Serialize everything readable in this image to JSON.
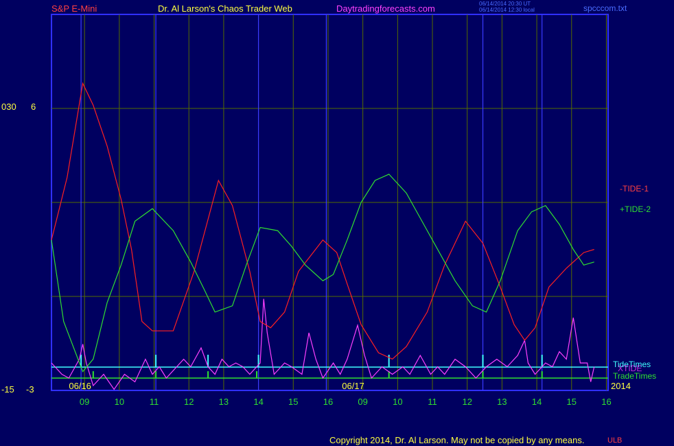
{
  "header": {
    "symbol": "S&P E-Mini",
    "site_title": "Dr. Al Larson's Chaos Trader Web",
    "site_url": "Daytradingforecasts.com",
    "timestamp_1": "06/14/2014 20:30 UT",
    "timestamp_2": "06/14/2014 12:30 local",
    "file_name": "spcccom.txt"
  },
  "footer": {
    "copyright": "Copyright 2014, Dr. Al Larson. May not be copied by any means.",
    "mark": "ULB"
  },
  "colors": {
    "background": "#000060",
    "frame": "#3030ff",
    "grid": "#556b00",
    "tide1": "#ff2020",
    "tide2": "#30e030",
    "xtide": "#ff40ff",
    "tidetimes": "#40ffff",
    "tradetimes": "#30e030",
    "day_marker": "#3a3aff",
    "axis_text": "#ffff40",
    "tick_text": "#30e030"
  },
  "chart_data": {
    "type": "line",
    "y_axis_labels": {
      "top_left": "030",
      "top_right": "6",
      "bottom_left": "-15",
      "bottom_right": "-3"
    },
    "date_labels": [
      "06/16",
      "06/17"
    ],
    "year_label": "2014",
    "x_ticks": [
      "09",
      "10",
      "11",
      "12",
      "13",
      "14",
      "15",
      "16",
      "09",
      "10",
      "11",
      "12",
      "13",
      "14",
      "15",
      "16"
    ],
    "x_range": [
      0,
      16
    ],
    "y_range": [
      -3,
      6
    ],
    "series": [
      {
        "name": "-TIDE-1",
        "points": [
          [
            0,
            1.8
          ],
          [
            0.45,
            3.8
          ],
          [
            0.9,
            6.8
          ],
          [
            1.2,
            6.1
          ],
          [
            1.6,
            4.8
          ],
          [
            2.0,
            3.1
          ],
          [
            2.3,
            1.5
          ],
          [
            2.6,
            -0.8
          ],
          [
            2.9,
            -1.1
          ],
          [
            3.5,
            -1.1
          ],
          [
            4.1,
            0.8
          ],
          [
            4.8,
            3.7
          ],
          [
            5.2,
            2.9
          ],
          [
            5.7,
            0.8
          ],
          [
            6.0,
            -0.8
          ],
          [
            6.3,
            -1.0
          ],
          [
            6.7,
            -0.5
          ],
          [
            7.1,
            0.8
          ],
          [
            7.8,
            1.8
          ],
          [
            8.2,
            1.4
          ],
          [
            8.5,
            0.4
          ],
          [
            8.9,
            -0.9
          ],
          [
            9.4,
            -1.8
          ],
          [
            9.8,
            -2.0
          ],
          [
            10.2,
            -1.6
          ],
          [
            10.8,
            -0.5
          ],
          [
            11.3,
            1.0
          ],
          [
            11.9,
            2.4
          ],
          [
            12.4,
            1.7
          ],
          [
            12.9,
            0.3
          ],
          [
            13.3,
            -0.9
          ],
          [
            13.6,
            -1.4
          ],
          [
            13.9,
            -1.0
          ],
          [
            14.3,
            0.3
          ],
          [
            14.8,
            0.9
          ],
          [
            15.3,
            1.4
          ],
          [
            15.6,
            1.5
          ]
        ]
      },
      {
        "name": "+TIDE-2",
        "points": [
          [
            0,
            1.8
          ],
          [
            0.35,
            -0.8
          ],
          [
            0.9,
            -2.4
          ],
          [
            1.2,
            -2.0
          ],
          [
            1.6,
            -0.2
          ],
          [
            2.0,
            1.0
          ],
          [
            2.4,
            2.4
          ],
          [
            2.9,
            2.8
          ],
          [
            3.5,
            2.1
          ],
          [
            4.0,
            1.1
          ],
          [
            4.4,
            0.2
          ],
          [
            4.7,
            -0.5
          ],
          [
            5.2,
            -0.3
          ],
          [
            5.6,
            1.0
          ],
          [
            6.0,
            2.2
          ],
          [
            6.5,
            2.1
          ],
          [
            6.9,
            1.6
          ],
          [
            7.3,
            1.0
          ],
          [
            7.8,
            0.5
          ],
          [
            8.1,
            0.7
          ],
          [
            8.5,
            1.8
          ],
          [
            8.9,
            3.0
          ],
          [
            9.3,
            3.7
          ],
          [
            9.7,
            3.9
          ],
          [
            10.2,
            3.3
          ],
          [
            10.7,
            2.3
          ],
          [
            11.2,
            1.3
          ],
          [
            11.6,
            0.5
          ],
          [
            12.1,
            -0.3
          ],
          [
            12.5,
            -0.5
          ],
          [
            12.9,
            0.5
          ],
          [
            13.4,
            2.1
          ],
          [
            13.8,
            2.7
          ],
          [
            14.2,
            2.9
          ],
          [
            14.6,
            2.3
          ],
          [
            15.0,
            1.5
          ],
          [
            15.3,
            1.0
          ],
          [
            15.6,
            1.1
          ]
        ]
      },
      {
        "name": "XTIDE",
        "points": [
          [
            0,
            0.2
          ],
          [
            0.3,
            -0.1
          ],
          [
            0.5,
            -0.2
          ],
          [
            0.8,
            0.3
          ],
          [
            0.9,
            0.7
          ],
          [
            1.0,
            0.2
          ],
          [
            1.2,
            -0.4
          ],
          [
            1.5,
            -0.1
          ],
          [
            1.8,
            -0.5
          ],
          [
            2.1,
            -0.1
          ],
          [
            2.4,
            -0.3
          ],
          [
            2.7,
            0.3
          ],
          [
            2.9,
            -0.1
          ],
          [
            3.1,
            0.1
          ],
          [
            3.3,
            -0.2
          ],
          [
            3.6,
            0.1
          ],
          [
            3.8,
            0.3
          ],
          [
            4.0,
            0.1
          ],
          [
            4.3,
            0.6
          ],
          [
            4.5,
            0.1
          ],
          [
            4.7,
            -0.1
          ],
          [
            4.9,
            0.3
          ],
          [
            5.1,
            0.1
          ],
          [
            5.3,
            0.2
          ],
          [
            5.5,
            0.1
          ],
          [
            5.7,
            -0.1
          ],
          [
            6.0,
            0.2
          ],
          [
            6.1,
            1.9
          ],
          [
            6.2,
            1.0
          ],
          [
            6.4,
            -0.1
          ],
          [
            6.7,
            0.2
          ],
          [
            6.9,
            0.1
          ],
          [
            7.2,
            -0.1
          ],
          [
            7.4,
            1.0
          ],
          [
            7.6,
            0.3
          ],
          [
            7.8,
            -0.2
          ],
          [
            8.1,
            0.2
          ],
          [
            8.3,
            -0.1
          ],
          [
            8.5,
            0.3
          ],
          [
            8.8,
            1.2
          ],
          [
            9.0,
            0.4
          ],
          [
            9.2,
            -0.2
          ],
          [
            9.5,
            0.1
          ],
          [
            9.8,
            -0.1
          ],
          [
            10.1,
            0.1
          ],
          [
            10.3,
            -0.1
          ],
          [
            10.6,
            0.4
          ],
          [
            10.9,
            -0.1
          ],
          [
            11.1,
            0.1
          ],
          [
            11.3,
            -0.1
          ],
          [
            11.6,
            0.3
          ],
          [
            11.9,
            0.1
          ],
          [
            12.2,
            -0.2
          ],
          [
            12.5,
            0.1
          ],
          [
            12.8,
            0.3
          ],
          [
            13.1,
            0.1
          ],
          [
            13.4,
            0.4
          ],
          [
            13.6,
            0.8
          ],
          [
            13.7,
            0.2
          ],
          [
            13.9,
            -0.1
          ],
          [
            14.2,
            0.2
          ],
          [
            14.4,
            0.1
          ],
          [
            14.6,
            0.5
          ],
          [
            14.8,
            0.3
          ],
          [
            15.0,
            1.4
          ],
          [
            15.2,
            0.2
          ],
          [
            15.4,
            0.2
          ],
          [
            15.5,
            -0.3
          ],
          [
            15.6,
            0.1
          ]
        ]
      }
    ],
    "tide_times_x": [
      0.85,
      3.0,
      4.5,
      5.95,
      9.7,
      12.4,
      14.1
    ],
    "trade_times_x": [
      1.2,
      3.0,
      4.5,
      5.9,
      9.7,
      12.4,
      14.1
    ],
    "day_markers_x": [
      0.85,
      3.0,
      5.95,
      7.9,
      12.4,
      14.1
    ],
    "legend": [
      "-TIDE-1",
      "+TIDE-2",
      "TideTimes",
      "XTIDE",
      "TradeTimes"
    ]
  }
}
